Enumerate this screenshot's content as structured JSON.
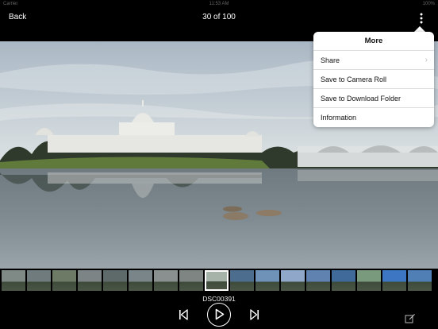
{
  "status": {
    "carrier": "Carrier",
    "time": "11:53 AM",
    "battery": "100%"
  },
  "nav": {
    "back_label": "Back",
    "title": "30 of 100",
    "more_icon": "more-vertical-icon"
  },
  "menu": {
    "title": "More",
    "items": [
      {
        "label": "Share",
        "has_chevron": true
      },
      {
        "label": "Save to Camera Roll"
      },
      {
        "label": "Save to Download Folder"
      },
      {
        "label": "Information"
      }
    ]
  },
  "filmstrip": {
    "count": 17,
    "selected_index": 8,
    "colors": [
      "#7f8a86",
      "#6f7b7d",
      "#6d7a66",
      "#7d8486",
      "#5e6a69",
      "#7a858a",
      "#8a8f8f",
      "#7e8582",
      "#a5b3a8",
      "#4d6d8f",
      "#6f93b8",
      "#8fa8c9",
      "#5f82b0",
      "#3f6a9a",
      "#7a9a7d",
      "#3d77c4",
      "#4f7fb5"
    ]
  },
  "current_file": "DSC00391",
  "controls": {
    "prev_icon": "skip-previous-icon",
    "play_icon": "play-icon",
    "next_icon": "skip-next-icon",
    "edit_icon": "edit-icon"
  }
}
